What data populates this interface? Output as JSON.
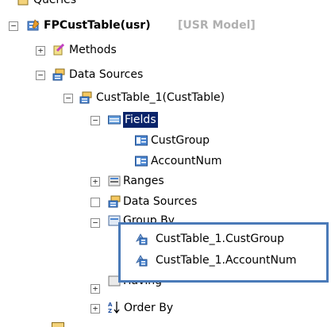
{
  "tree": {
    "queries_label": "Queries",
    "root_label": "FPCustTable(usr)",
    "root_layer": "[USR Model]",
    "methods_label": "Methods",
    "datasources_label": "Data Sources",
    "custtable_label": "CustTable_1(CustTable)",
    "fields_label": "Fields",
    "field_custgroup": "CustGroup",
    "field_accountnum": "AccountNum",
    "ranges_label": "Ranges",
    "nested_datasources_label": "Data Sources",
    "groupby_label": "Group By",
    "having_label": "Having",
    "orderby_label": "Order By"
  },
  "callout": {
    "items": [
      "CustTable_1.CustGroup",
      "CustTable_1.AccountNum"
    ],
    "border_color": "#4a7ab8"
  },
  "expander": {
    "plus": "+",
    "minus": "−"
  },
  "colors": {
    "selection": "#0a246a",
    "selection_text": "#ffffff",
    "layer_text": "#b0b0b0"
  }
}
